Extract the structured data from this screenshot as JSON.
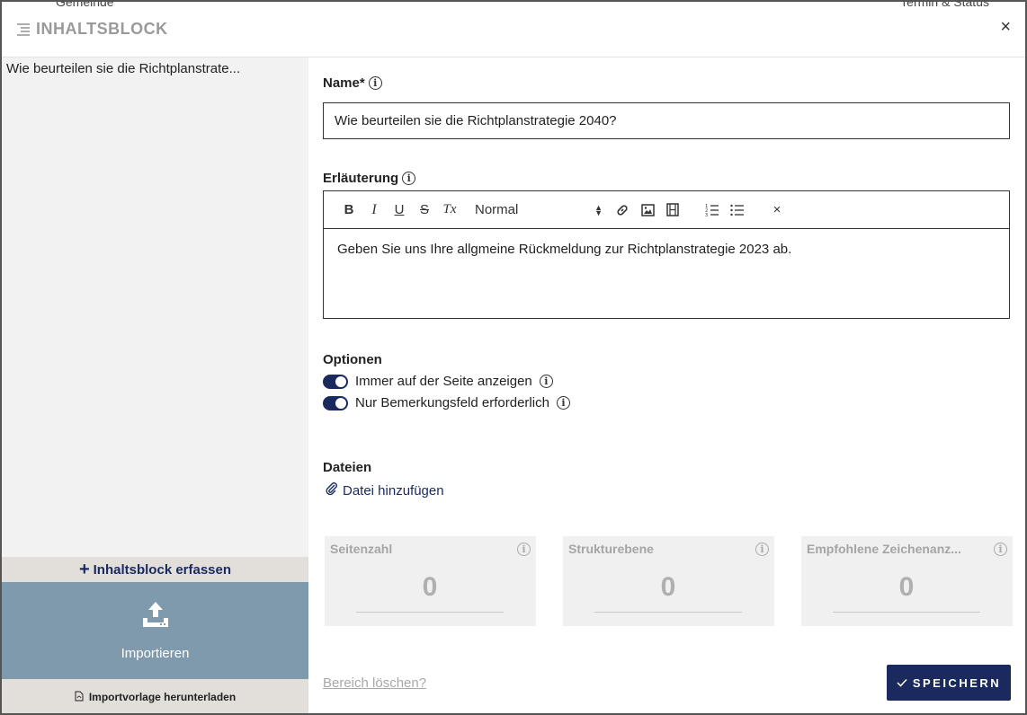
{
  "header": {
    "title": "INHALTSBLOCK",
    "close_label": "×",
    "background_left": "Gemeinde",
    "background_right": "Termin & Status"
  },
  "sidebar": {
    "entries": [
      "Wie beurteilen sie die Richtplanstrate..."
    ],
    "add_label": "Inhaltsblock erfassen",
    "import_label": "Importieren",
    "template_label": "Importvorlage herunterladen"
  },
  "form": {
    "name_label": "Name*",
    "name_value": "Wie beurteilen sie die Richtplanstrategie 2040?",
    "explanation_label": "Erläuterung",
    "toolbar": {
      "bold": "B",
      "italic": "I",
      "underline": "U",
      "strike": "S",
      "clear_format": "Tx",
      "style_select": "Normal",
      "clear": "×"
    },
    "explanation_text": "Geben Sie uns Ihre allgmeine Rückmeldung zur Richtplanstrategie 2023 ab.",
    "options_label": "Optionen",
    "options": [
      {
        "label": "Immer auf der Seite anzeigen",
        "on": true
      },
      {
        "label": "Nur Bemerkungsfeld erforderlich",
        "on": true
      }
    ],
    "files_label": "Dateien",
    "add_file_label": "Datei hinzufügen"
  },
  "stats": [
    {
      "title": "Seitenzahl",
      "value": "0"
    },
    {
      "title": "Strukturebene",
      "value": "0"
    },
    {
      "title": "Empfohlene Zeichenanz...",
      "value": "0"
    }
  ],
  "footer": {
    "delete_label": "Bereich löschen?",
    "save_label": "SPEICHERN"
  },
  "colors": {
    "primary": "#1a2a5e",
    "import_bg": "#7f99ad",
    "sidebar_bg": "#f2f2f2",
    "accent_bar": "#e2dfdb"
  }
}
